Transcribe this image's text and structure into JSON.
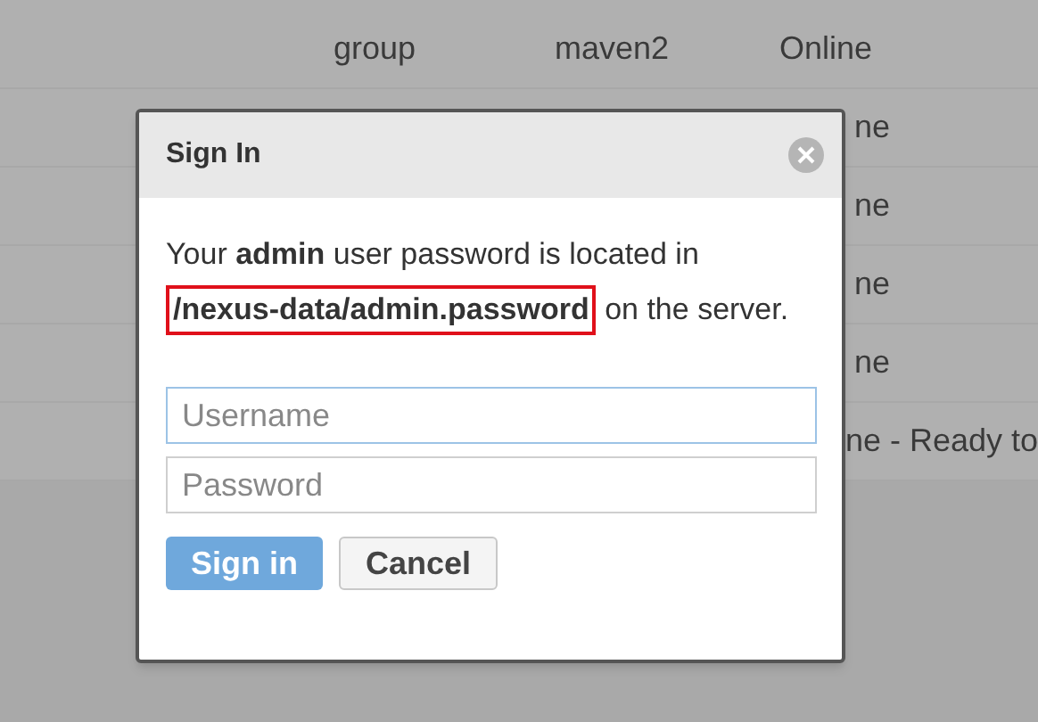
{
  "table": {
    "rows": [
      {
        "column_1": "group",
        "column_2": "maven2",
        "column_3": "Online"
      },
      {
        "column_3": "ne"
      },
      {
        "column_3": "ne"
      },
      {
        "column_3": "ne"
      },
      {
        "column_3": "ne"
      },
      {
        "column_3": "ne - Ready to"
      }
    ]
  },
  "dialog": {
    "title": "Sign In",
    "message_before": "Your **admin** user password is located in",
    "path": "/nexus-data/admin.password",
    "message_after": "on the server.",
    "fields": [
      {
        "placeholder": "Username",
        "focused": true
      },
      {
        "placeholder": "Password",
        "focused": false
      }
    ],
    "buttons": [
      {
        "label": "Sign in",
        "kind": "primary"
      },
      {
        "label": "Cancel",
        "kind": "secondary"
      }
    ]
  }
}
